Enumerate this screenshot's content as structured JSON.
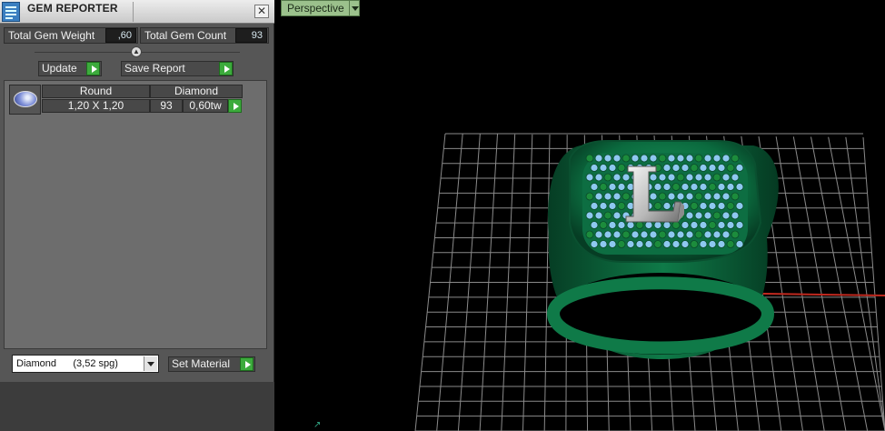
{
  "panel": {
    "title": "GEM REPORTER",
    "close_glyph": "✕",
    "total_weight_label": "Total Gem Weight",
    "total_weight_value": ",60",
    "total_count_label": "Total Gem Count",
    "total_count_value": "93",
    "update_label": "Update",
    "save_report_label": "Save Report",
    "table": {
      "headers": [
        "Round",
        "Diamond"
      ],
      "row": {
        "size": "1,20 X 1,20",
        "count": "93",
        "weight": "0,60tw"
      }
    },
    "material": {
      "selected": "Diamond      (3,52 spg)"
    },
    "set_material_label": "Set Material"
  },
  "viewport": {
    "view_name": "Perspective",
    "letter": "L"
  },
  "colors": {
    "panel_bg": "#565656",
    "accent_green": "#3cab3c",
    "ring_green": "#0e7a4a",
    "gem_blue": "#8ec8f0",
    "view_tab": "#9bc18c"
  },
  "icons": [
    "gem-reporter-icon",
    "close-icon",
    "slider-knob-icon",
    "play-icon",
    "dropdown-arrow-icon",
    "diamond-gem-icon"
  ]
}
